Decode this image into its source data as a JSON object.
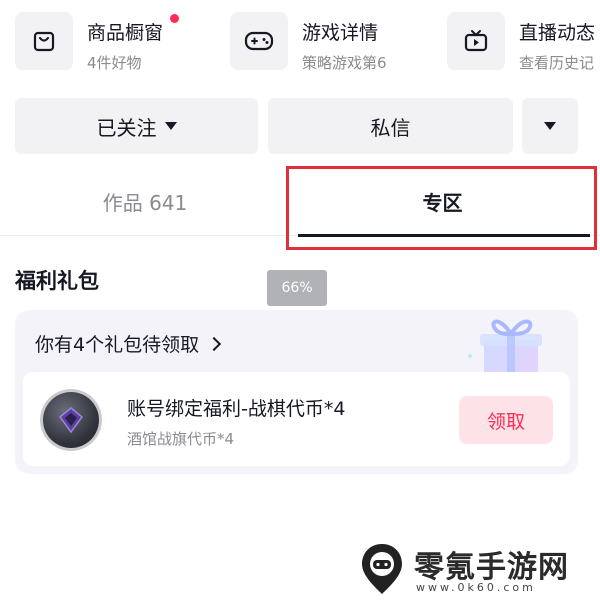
{
  "features": [
    {
      "title": "商品橱窗",
      "subtitle": "4件好物",
      "icon": "storefront-icon",
      "has_dot": true
    },
    {
      "title": "游戏详情",
      "subtitle": "策略游戏第6",
      "icon": "gamepad-icon",
      "has_dot": false
    },
    {
      "title": "直播动态",
      "subtitle": "查看历史记",
      "icon": "tv-icon",
      "has_dot": false
    }
  ],
  "actions": {
    "follow_label": "已关注",
    "message_label": "私信"
  },
  "tabs": {
    "works_label": "作品 641",
    "zone_label": "专区"
  },
  "zoom_badge": "66%",
  "gift_section": {
    "title": "福利礼包",
    "card_header": "你有4个礼包待领取",
    "item": {
      "title": "账号绑定福利-战棋代币*4",
      "subtitle": "酒馆战旗代币*4",
      "claim_label": "领取"
    }
  },
  "watermark": {
    "name": "零氪手游网",
    "url": "www.0k60.com"
  },
  "colors": {
    "accent": "#fe2c55",
    "highlight_box": "#e02e3a",
    "button_bg": "#f2f2f4",
    "card_bg": "#f4f3fa"
  }
}
